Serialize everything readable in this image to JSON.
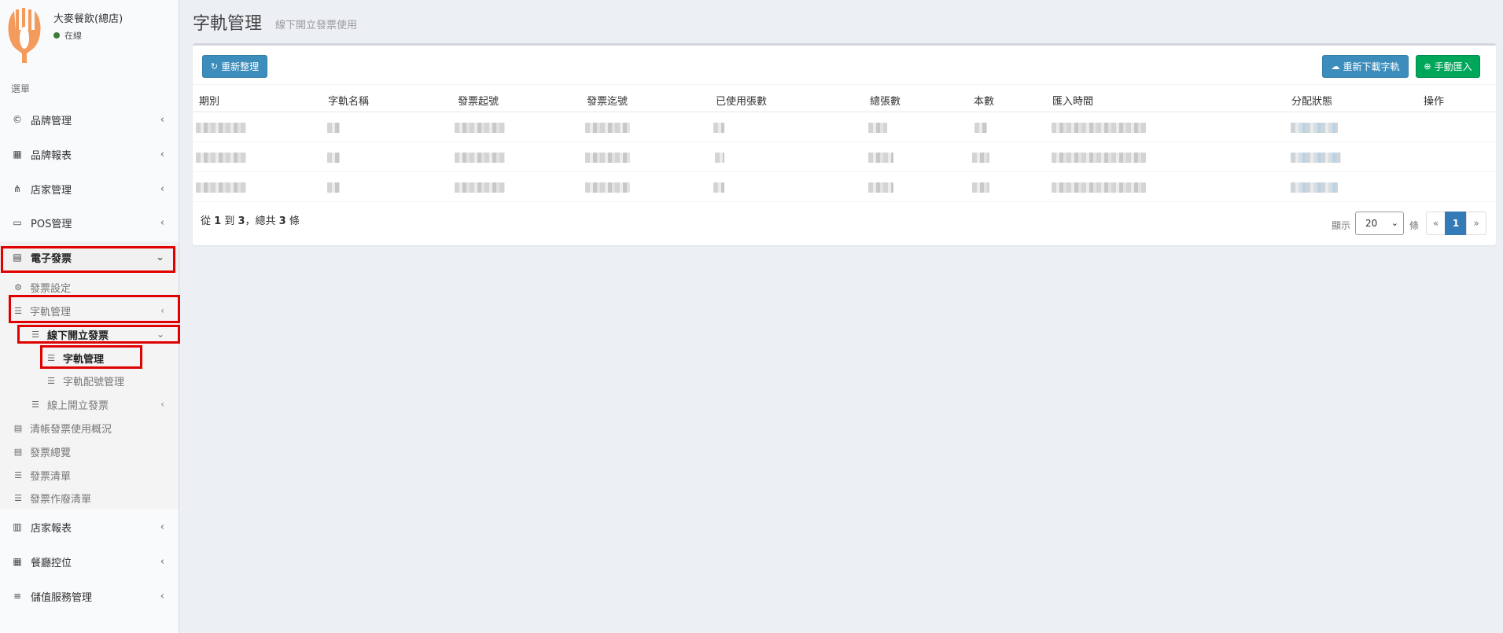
{
  "user": {
    "name": "大麥餐飲(總店)",
    "status": "在線"
  },
  "menu_header": "選單",
  "nav": [
    {
      "icon": "©",
      "label": "品牌管理"
    },
    {
      "icon": "▦",
      "label": "品牌報表"
    },
    {
      "icon": "⋔",
      "label": "店家管理"
    },
    {
      "icon": "▭",
      "label": "POS管理"
    },
    {
      "icon": "▤",
      "label": "電子發票"
    },
    {
      "icon": "▥",
      "label": "店家報表"
    },
    {
      "icon": "▦",
      "label": "餐廳控位"
    },
    {
      "icon": "≡",
      "label": "儲值服務管理"
    }
  ],
  "submenu": [
    {
      "icon": "⚙",
      "label": "發票設定"
    },
    {
      "icon": "☰",
      "label": "字軌管理"
    },
    {
      "icon": "☰",
      "label": "線下開立發票"
    },
    {
      "icon": "☰",
      "label": "字軌管理"
    },
    {
      "icon": "☰",
      "label": "字軌配號管理"
    },
    {
      "icon": "☰",
      "label": "線上開立發票"
    },
    {
      "icon": "▤",
      "label": "清帳發票使用概況"
    },
    {
      "icon": "▤",
      "label": "發票總覽"
    },
    {
      "icon": "☰",
      "label": "發票清單"
    },
    {
      "icon": "☰",
      "label": "發票作廢清單"
    }
  ],
  "page": {
    "title": "字軌管理",
    "subtitle": "線下開立發票使用"
  },
  "toolbar": {
    "refresh_label": "重新整理",
    "download_label": "重新下載字軌",
    "import_label": "手動匯入"
  },
  "table": {
    "columns": [
      "期別",
      "字軌名稱",
      "發票起號",
      "發票迄號",
      "已使用張數",
      "總張數",
      "本數",
      "匯入時間",
      "分配狀態",
      "操作"
    ],
    "row_count": 3
  },
  "footer": {
    "info_prefix": "從 ",
    "info_from": "1",
    "info_mid": " 到 ",
    "info_to": "3",
    "info_total_prefix": "，總共 ",
    "info_total": "3",
    "info_suffix": " 條",
    "show_label": "顯示",
    "page_size": "20",
    "unit_label": "條",
    "prev": "«",
    "current_page": "1",
    "next": "»"
  }
}
